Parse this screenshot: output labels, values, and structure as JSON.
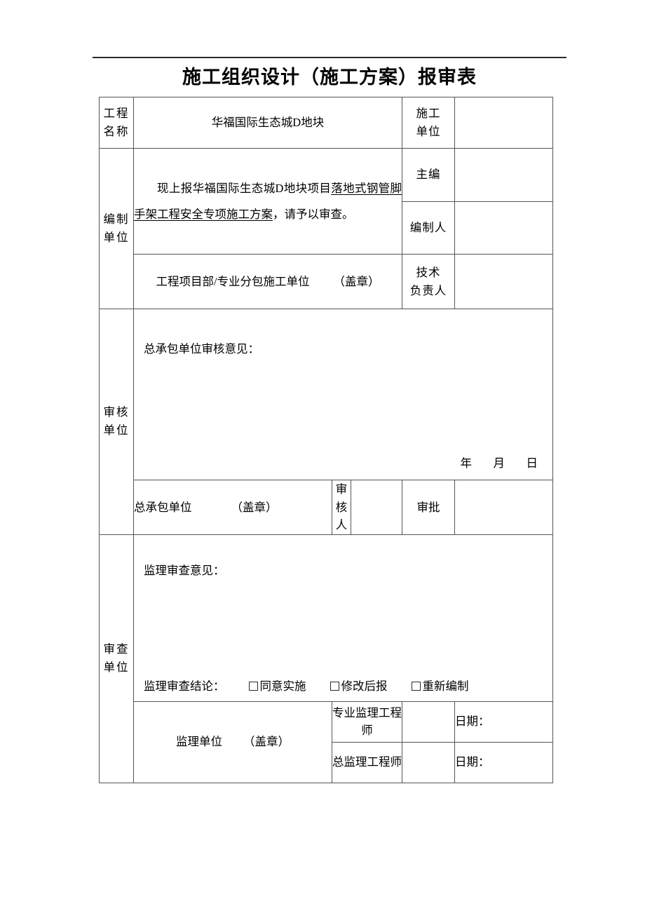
{
  "document": {
    "title": "施工组织设计（施工方案）报审表"
  },
  "table": {
    "project_name": {
      "label_line1": "工程",
      "label_line2": "名称",
      "value": "华福国际生态城D地块",
      "construction_unit_label_line1": "施工",
      "construction_unit_label_line2": "单位",
      "construction_unit_value": ""
    },
    "preparing_unit": {
      "label_line1": "编制",
      "label_line2": "单位",
      "body_prefix": "现上报华福国际生态城D地块项目",
      "body_underlined": "落地式钢管脚手架工程安全专项施工方案",
      "body_suffix": "，请予以审查。",
      "chief_editor_label": "主编",
      "chief_editor_value": "",
      "preparer_label": "编制人",
      "preparer_value": "",
      "stamp_row_text": "工程项目部/专业分包施工单位",
      "stamp_row_seal": "（盖章）",
      "tech_leader_label_line1": "技术",
      "tech_leader_label_line2": "负责人",
      "tech_leader_value": ""
    },
    "review_unit": {
      "label_line1": "审核",
      "label_line2": "单位",
      "opinion_label": "总承包单位审核意见：",
      "opinion_value": "",
      "date_line": "年　月　日",
      "signature_unit_label": "总承包单位",
      "signature_unit_seal": "（盖章）",
      "reviewer_label": "审核人",
      "reviewer_value": "",
      "approver_label": "审批",
      "approver_value": ""
    },
    "examine_unit": {
      "label_line1": "审查",
      "label_line2": "单位",
      "opinion_label": "监理审查意见：",
      "opinion_value": "",
      "conclusion_label": "监理审查结论：",
      "options": [
        "同意实施",
        "修改后报",
        "重新编制"
      ],
      "supervision_unit_label": "监理单位",
      "supervision_unit_seal": "（盖章）",
      "rows": [
        {
          "role": "专业监理工程师",
          "signature": "",
          "date_label": "日期："
        },
        {
          "role": "总监理工程师",
          "signature": "",
          "date_label": "日期："
        }
      ]
    }
  }
}
